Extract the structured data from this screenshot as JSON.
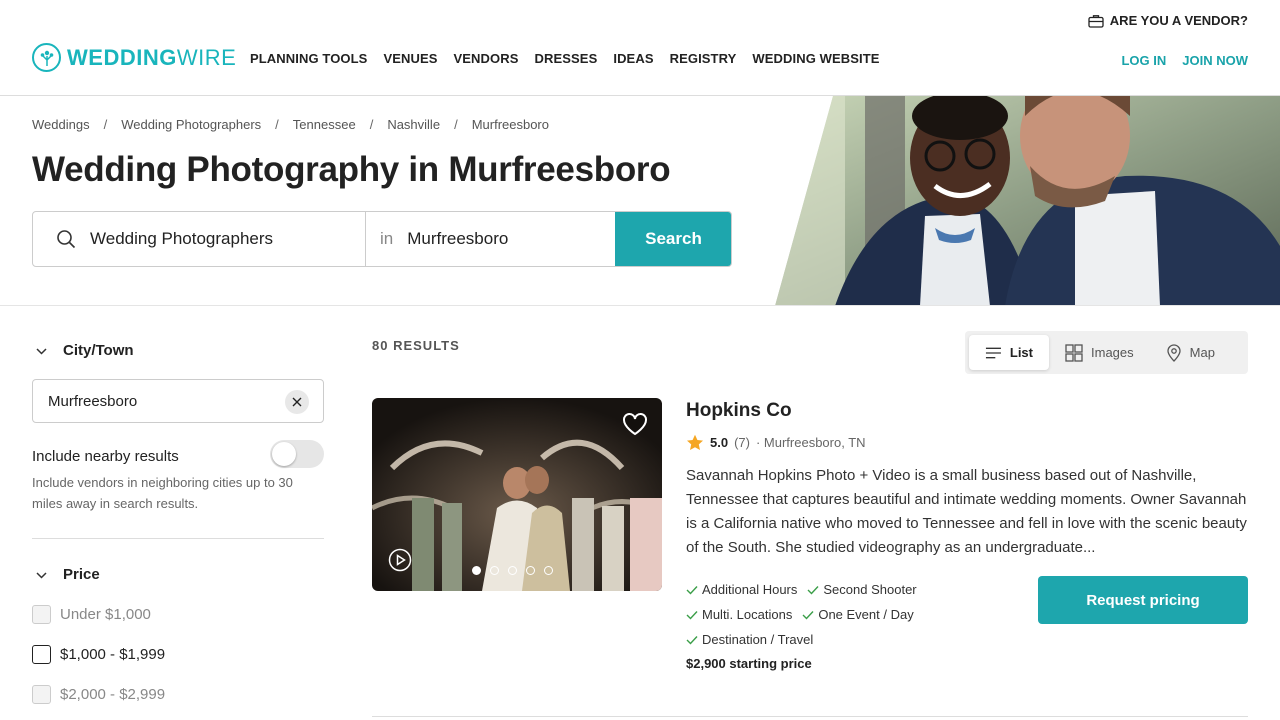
{
  "header": {
    "vendor_link": "ARE YOU A VENDOR?",
    "logo": {
      "bold": "WEDDING",
      "thin": "WIRE"
    },
    "nav": [
      "PLANNING TOOLS",
      "VENUES",
      "VENDORS",
      "DRESSES",
      "IDEAS",
      "REGISTRY",
      "WEDDING WEBSITE"
    ],
    "login": "LOG IN",
    "join": "JOIN NOW"
  },
  "breadcrumb": [
    "Weddings",
    "Wedding Photographers",
    "Tennessee",
    "Nashville",
    "Murfreesboro"
  ],
  "page_title": "Wedding Photography in Murfreesboro",
  "search": {
    "what": "Wedding Photographers",
    "in_label": "in",
    "where": "Murfreesboro",
    "button": "Search"
  },
  "filters": {
    "city_heading": "City/Town",
    "city_value": "Murfreesboro",
    "nearby_label": "Include nearby results",
    "nearby_enabled": false,
    "nearby_help": "Include vendors in neighboring cities up to 30 miles away in search results.",
    "price_heading": "Price",
    "price_options": [
      "Under $1,000",
      "$1,000 - $1,999",
      "$2,000 - $2,999"
    ]
  },
  "results": {
    "count": "80 RESULTS",
    "views": [
      "List",
      "Images",
      "Map"
    ],
    "active_view": "List"
  },
  "listing": {
    "name": "Hopkins Co",
    "score": "5.0",
    "reviews": "(7)",
    "location": "· Murfreesboro, TN",
    "description": "Savannah Hopkins Photo + Video is a small business based out of Nashville, Tennessee that captures beautiful and intimate wedding moments. Owner Savannah is a California native who moved to Tennessee and fell in love with the scenic beauty of the South. She studied videography as an undergraduate...",
    "features": [
      "Additional Hours",
      "Second Shooter",
      "Multi. Locations",
      "One Event / Day",
      "Destination / Travel"
    ],
    "price": "$2,900 starting price",
    "cta": "Request pricing"
  },
  "colors": {
    "brand": "#19b5bc",
    "button": "#1ea6ad",
    "star": "#f5a623"
  }
}
